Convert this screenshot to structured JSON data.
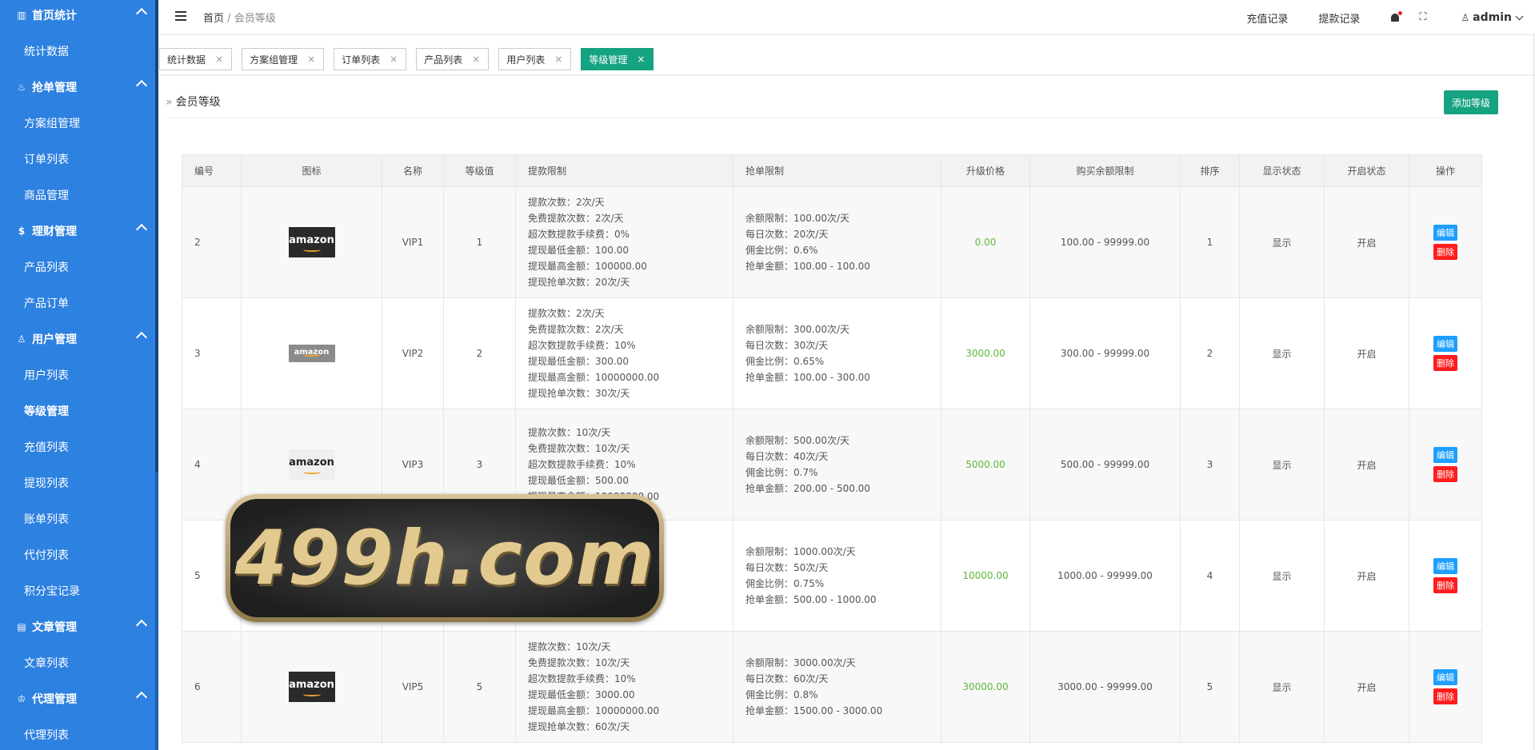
{
  "sidebar": {
    "groups": [
      {
        "label": "首页统计",
        "icon": "bar-chart-icon",
        "items": [
          "统计数据"
        ]
      },
      {
        "label": "抢单管理",
        "icon": "fire-icon",
        "items": [
          "方案组管理",
          "订单列表",
          "商品管理"
        ]
      },
      {
        "label": "理财管理",
        "icon": "money-icon",
        "items": [
          "产品列表",
          "产品订单"
        ]
      },
      {
        "label": "用户管理",
        "icon": "user-icon",
        "items": [
          "用户列表",
          "等级管理",
          "充值列表",
          "提现列表",
          "账单列表",
          "代付列表",
          "积分宝记录"
        ]
      },
      {
        "label": "文章管理",
        "icon": "document-icon",
        "items": [
          "文章列表"
        ]
      },
      {
        "label": "代理管理",
        "icon": "agent-icon",
        "items": [
          "代理列表"
        ]
      }
    ],
    "active_item": "等级管理"
  },
  "header": {
    "breadcrumb_home": "首页",
    "breadcrumb_sep": "/",
    "breadcrumb_current": "会员等级",
    "recharge_link": "充值记录",
    "withdraw_link": "提款记录",
    "user": "admin"
  },
  "tabs": [
    {
      "label": "统计数据",
      "close": "×"
    },
    {
      "label": "方案组管理",
      "close": "×"
    },
    {
      "label": "订单列表",
      "close": "×"
    },
    {
      "label": "产品列表",
      "close": "×"
    },
    {
      "label": "用户列表",
      "close": "×"
    },
    {
      "label": "等级管理",
      "close": "×",
      "active": true
    }
  ],
  "panel": {
    "title_arrow": "»",
    "title": "会员等级",
    "add_button": "添加等级"
  },
  "table": {
    "headers": [
      "编号",
      "图标",
      "名称",
      "等级值",
      "提款限制",
      "抢单限制",
      "升级价格",
      "购买余额限制",
      "排序",
      "显示状态",
      "开启状态",
      "操作"
    ],
    "edit_label": "编辑",
    "delete_label": "删除",
    "rows": [
      {
        "id": "2",
        "logo": "amazon",
        "name": "VIP1",
        "level": "1",
        "withdraw": [
          "提款次数：2次/天",
          "免费提款次数：2次/天",
          "超次数提款手续费：0%",
          "提现最低金额：100.00",
          "提现最高金额：100000.00",
          "提现抢单次数：20次/天"
        ],
        "grab": [
          "余额限制：100.00次/天",
          "每日次数：20次/天",
          "佣金比例：0.6%",
          "抢单金额：100.00 - 100.00"
        ],
        "price": "0.00",
        "balance": "100.00 - 99999.00",
        "sort": "1",
        "display": "显示",
        "open": "开启"
      },
      {
        "id": "3",
        "logo": "amazon",
        "name": "VIP2",
        "level": "2",
        "withdraw": [
          "提款次数：2次/天",
          "免费提款次数：2次/天",
          "超次数提款手续费：10%",
          "提现最低金额：300.00",
          "提现最高金额：10000000.00",
          "提现抢单次数：30次/天"
        ],
        "grab": [
          "余额限制：300.00次/天",
          "每日次数：30次/天",
          "佣金比例：0.65%",
          "抢单金额：100.00 - 300.00"
        ],
        "price": "3000.00",
        "balance": "300.00 - 99999.00",
        "sort": "2",
        "display": "显示",
        "open": "开启"
      },
      {
        "id": "4",
        "logo": "amazon",
        "name": "VIP3",
        "level": "3",
        "withdraw": [
          "提款次数：10次/天",
          "免费提款次数：10次/天",
          "超次数提款手续费：10%",
          "提现最低金额：500.00",
          "提现最高金额：10000000.00"
        ],
        "grab": [
          "余额限制：500.00次/天",
          "每日次数：40次/天",
          "佣金比例：0.7%",
          "抢单金额：200.00 - 500.00"
        ],
        "price": "5000.00",
        "balance": "500.00 - 99999.00",
        "sort": "3",
        "display": "显示",
        "open": "开启"
      },
      {
        "id": "5",
        "logo": "",
        "name": "",
        "level": "",
        "withdraw": [],
        "grab": [
          "余额限制：1000.00次/天",
          "每日次数：50次/天",
          "佣金比例：0.75%",
          "抢单金额：500.00 - 1000.00"
        ],
        "price": "10000.00",
        "balance": "1000.00 - 99999.00",
        "sort": "4",
        "display": "显示",
        "open": "开启"
      },
      {
        "id": "6",
        "logo": "amazon",
        "name": "VIP5",
        "level": "5",
        "withdraw": [
          "提款次数：10次/天",
          "免费提款次数：10次/天",
          "超次数提款手续费：10%",
          "提现最低金额：3000.00",
          "提现最高金额：10000000.00",
          "提现抢单次数：60次/天"
        ],
        "grab": [
          "余额限制：3000.00次/天",
          "每日次数：60次/天",
          "佣金比例：0.8%",
          "抢单金额：1500.00 - 3000.00"
        ],
        "price": "30000.00",
        "balance": "3000.00 - 99999.00",
        "sort": "5",
        "display": "显示",
        "open": "开启"
      }
    ]
  },
  "watermark": {
    "text": "499h.com"
  },
  "colors": {
    "sidebar": "#2d81e0",
    "accent": "#16a381",
    "price": "#5fb83b",
    "edit": "#1e9fff",
    "delete": "#ff1d1d"
  }
}
